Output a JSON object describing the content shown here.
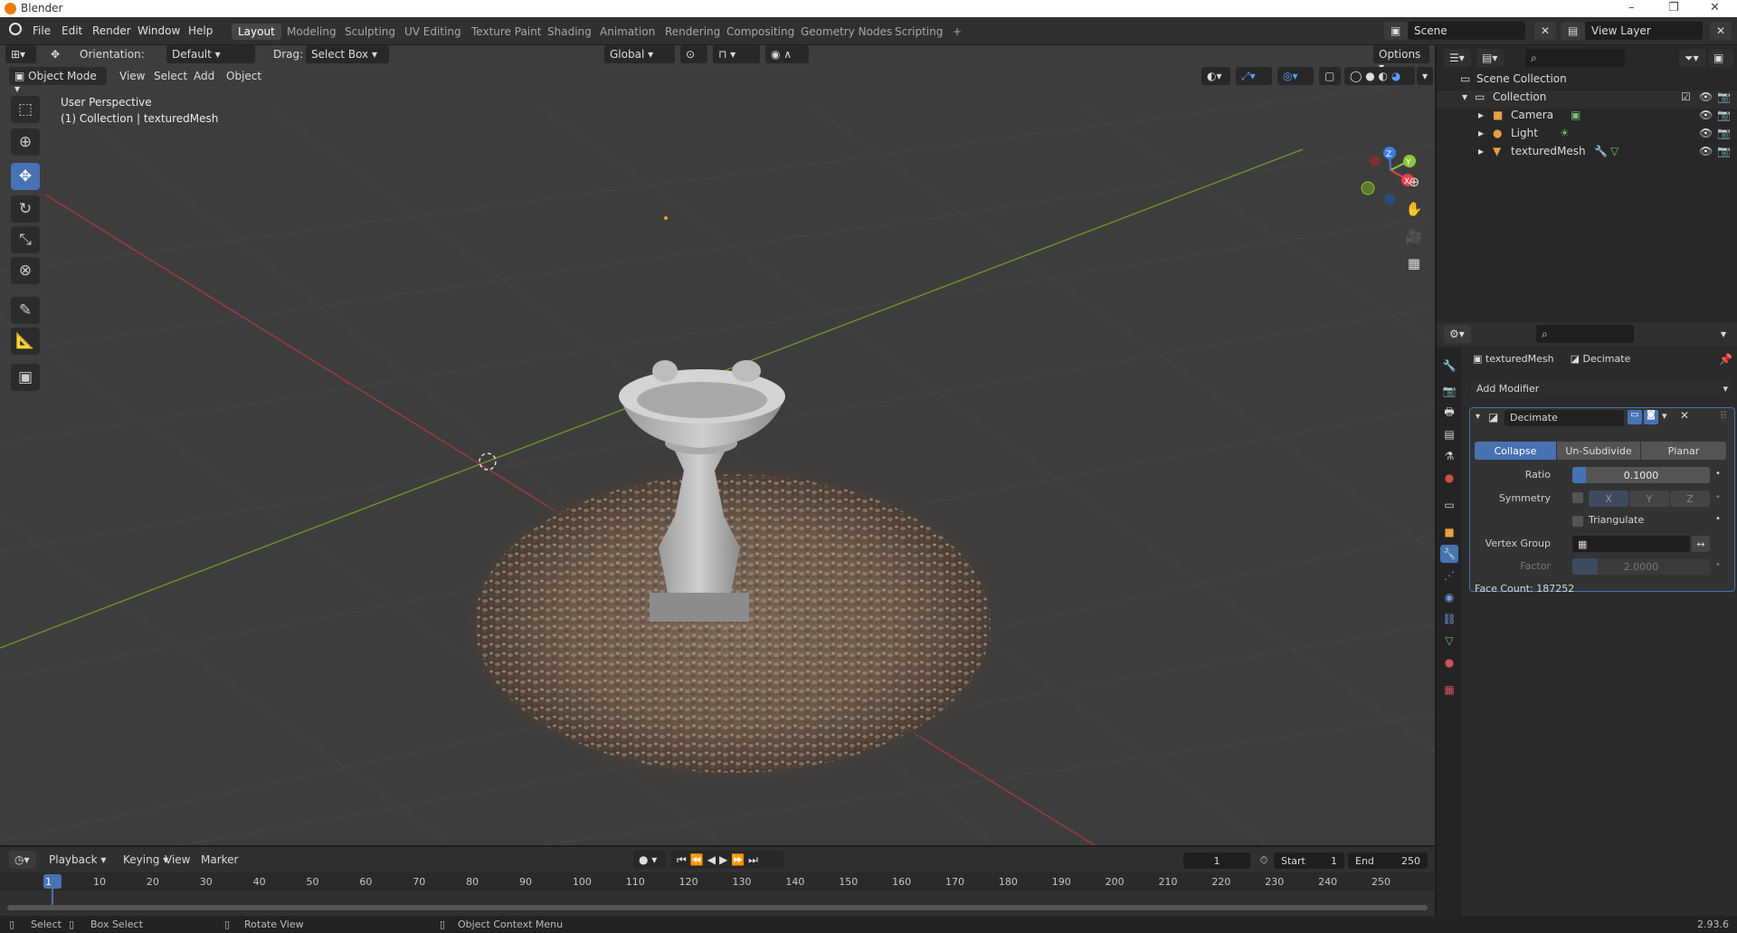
{
  "titlebar": {
    "title": "Blender",
    "minimize": "–",
    "maximize": "❐",
    "close": "✕"
  },
  "menu": [
    "File",
    "Edit",
    "Render",
    "Window",
    "Help"
  ],
  "workspaces": [
    "Layout",
    "Modeling",
    "Sculpting",
    "UV Editing",
    "Texture Paint",
    "Shading",
    "Animation",
    "Rendering",
    "Compositing",
    "Geometry Nodes",
    "Scripting"
  ],
  "active_workspace": "Layout",
  "add_workspace": "+",
  "scene": {
    "name": "Scene",
    "view_layer": "View Layer"
  },
  "viewport": {
    "orientation_label": "Orientation:",
    "orientation_value": "Default",
    "drag_label": "Drag:",
    "drag_value": "Select Box",
    "transform_orientation": "Global",
    "options": "Options",
    "mode": "Object Mode",
    "menus": [
      "View",
      "Select",
      "Add",
      "Object"
    ],
    "perspective": "User Perspective",
    "collection_info": "(1) Collection | texturedMesh",
    "gizmo": {
      "x": "X",
      "y": "Y",
      "z": "Z"
    }
  },
  "tools": [
    "select-box",
    "cursor",
    "move",
    "rotate",
    "scale",
    "transform",
    "annotate",
    "measure",
    "add-cube"
  ],
  "nav_icons": [
    "zoom-icon",
    "hand-icon",
    "camera-icon",
    "grid-icon"
  ],
  "timeline": {
    "menus": [
      "Playback",
      "Keying",
      "View",
      "Marker"
    ],
    "current_frame": "1",
    "start_label": "Start",
    "start": "1",
    "end_label": "End",
    "end": "250",
    "ticks": [
      "1",
      "10",
      "20",
      "30",
      "40",
      "50",
      "60",
      "70",
      "80",
      "90",
      "100",
      "110",
      "120",
      "130",
      "140",
      "150",
      "160",
      "170",
      "180",
      "190",
      "200",
      "210",
      "220",
      "230",
      "240",
      "250"
    ]
  },
  "outliner": {
    "scene_collection": "Scene Collection",
    "collection": "Collection",
    "items": [
      "Camera",
      "Light",
      "texturedMesh"
    ]
  },
  "properties": {
    "object": "texturedMesh",
    "modifier_crumb": "Decimate",
    "add_modifier": "Add Modifier",
    "modifier_name": "Decimate",
    "modes": [
      "Collapse",
      "Un-Subdivide",
      "Planar"
    ],
    "active_mode": "Collapse",
    "ratio_label": "Ratio",
    "ratio": "0.1000",
    "ratio_fill": 0.1,
    "symmetry_label": "Symmetry",
    "sym_axes": [
      "X",
      "Y",
      "Z"
    ],
    "triangulate": "Triangulate",
    "vertex_group_label": "Vertex Group",
    "factor_label": "Factor",
    "factor": "2.0000",
    "face_count": "Face Count: 187252"
  },
  "statusbar": {
    "select": "Select",
    "box_select": "Box Select",
    "rotate_view": "Rotate View",
    "context_menu": "Object Context Menu",
    "version": "2.93.6"
  },
  "colors": {
    "accent": "#4772b3",
    "x_axis": "#e2424a",
    "y_axis": "#8cc63f",
    "z_axis": "#3d7ee0",
    "bg_viewport": "#3d3d3d"
  }
}
